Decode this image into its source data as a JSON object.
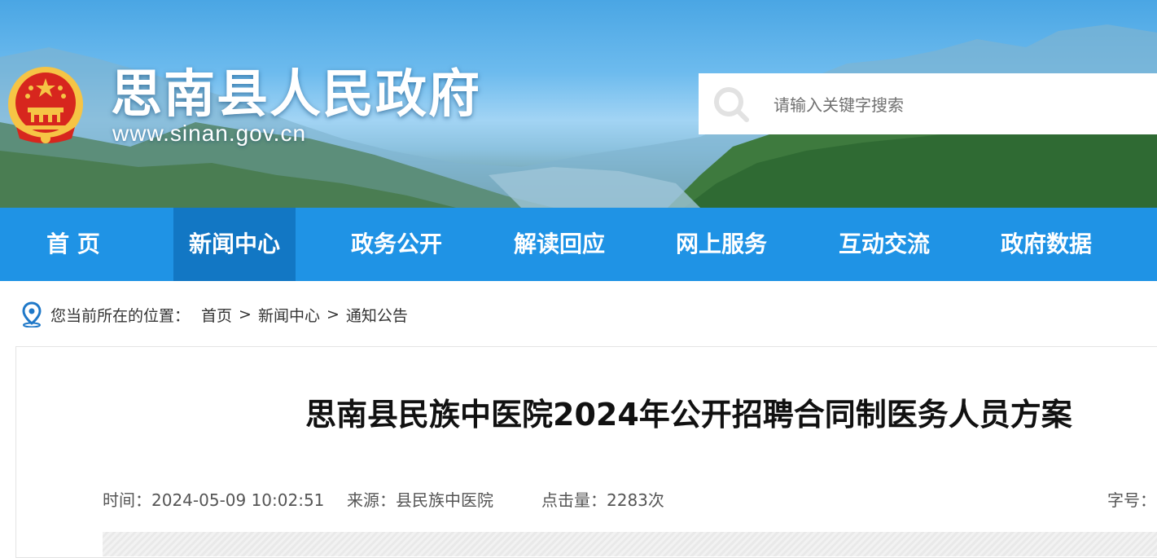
{
  "header": {
    "site_title": "思南县人民政府",
    "site_url": "www.sinan.gov.cn",
    "search_placeholder": "请输入关键字搜索"
  },
  "nav": {
    "items": [
      {
        "label": "首 页",
        "active": false
      },
      {
        "label": "新闻中心",
        "active": true
      },
      {
        "label": "政务公开",
        "active": false
      },
      {
        "label": "解读回应",
        "active": false
      },
      {
        "label": "网上服务",
        "active": false
      },
      {
        "label": "互动交流",
        "active": false
      },
      {
        "label": "政府数据",
        "active": false
      }
    ]
  },
  "breadcrumb": {
    "prefix": "您当前所在的位置：",
    "items": [
      "首页",
      "新闻中心",
      "通知公告"
    ],
    "separator": ">"
  },
  "article": {
    "title": "思南县民族中医院2024年公开招聘合同制医务人员方案",
    "time": "时间：2024-05-09 10:02:51",
    "source": "来源：县民族中医院",
    "views": "点击量：2283次",
    "font_size_label": "字号："
  },
  "colors": {
    "nav_bg": "#1f93e5",
    "nav_active_bg": "#1277c4",
    "emblem_red": "#d7261e",
    "emblem_gold": "#f6c445"
  }
}
